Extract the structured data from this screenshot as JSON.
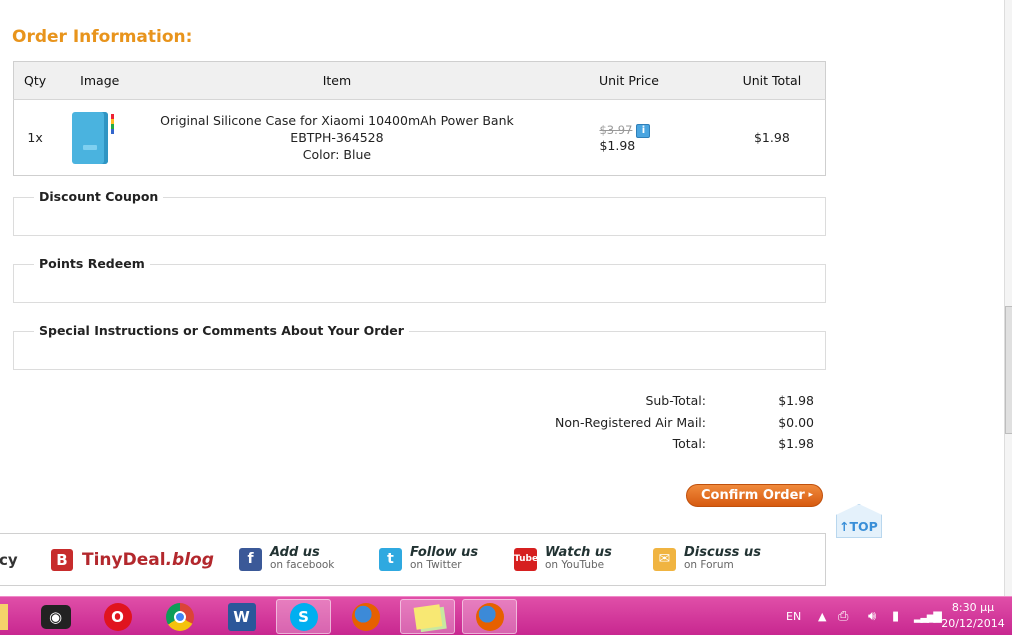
{
  "order": {
    "title": "Order Information:",
    "columns": {
      "qty": "Qty",
      "image": "Image",
      "item": "Item",
      "unit_price": "Unit Price",
      "unit_total": "Unit Total"
    },
    "item": {
      "qty": "1x",
      "name": "Original Silicone Case for Xiaomi 10400mAh Power Bank EBTPH-364528",
      "color": "Color: Blue",
      "old_price": "$3.97",
      "price": "$1.98",
      "total": "$1.98"
    }
  },
  "sections": {
    "discount": "Discount Coupon",
    "points": "Points Redeem",
    "instructions": "Special Instructions or Comments About Your Order"
  },
  "totals": {
    "subtotal_label": "Sub-Total:",
    "subtotal": "$1.98",
    "shipping_label": "Non-Registered Air Mail:",
    "shipping": "$0.00",
    "total_label": "Total:",
    "total": "$1.98"
  },
  "buttons": {
    "confirm": "Confirm Order",
    "top": "TOP"
  },
  "footer": {
    "cut_text": "cy",
    "brand_name": "TinyDeal",
    "brand_suffix": ".blog",
    "links": [
      {
        "title": "Add us",
        "sub": "on facebook"
      },
      {
        "title": "Follow us",
        "sub": "on Twitter"
      },
      {
        "title": "Watch us",
        "sub": "on YouTube"
      },
      {
        "title": "Discuss us",
        "sub": "on Forum"
      }
    ]
  },
  "taskbar": {
    "apps": [
      "file-explorer",
      "camera",
      "opera",
      "chrome",
      "word",
      "skype",
      "firefox",
      "sticky-notes",
      "firefox"
    ],
    "lang": "EN",
    "time": "8:30 μμ",
    "date": "20/12/2014"
  },
  "colors": {
    "accent_orange": "#e8941c",
    "button_orange": "#e06a1e",
    "taskbar_pink": "#d535a0",
    "top_blue": "#3a8fd8"
  }
}
